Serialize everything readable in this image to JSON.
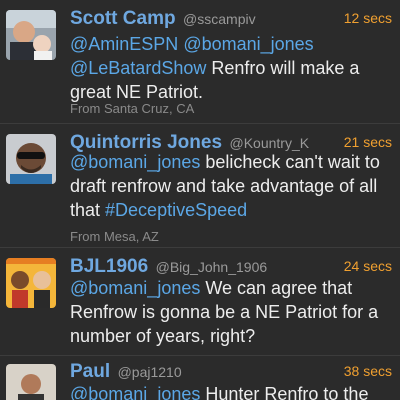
{
  "tweets": [
    {
      "name": "Scott Camp",
      "handle": "@sscampiv",
      "time": "12 secs",
      "segments": [
        {
          "type": "mention",
          "text": "@AminESPN"
        },
        {
          "type": "text",
          "text": " "
        },
        {
          "type": "mention",
          "text": "@bomani_jones"
        },
        {
          "type": "text",
          "text": " "
        },
        {
          "type": "mention",
          "text": "@LeBatardShow"
        },
        {
          "type": "text",
          "text": " Renfro will make a great NE Patriot."
        }
      ],
      "location": "From Santa Cruz, CA"
    },
    {
      "name": "Quintorris Jones",
      "handle": "@Kountry_K",
      "time": "21 secs",
      "segments": [
        {
          "type": "mention",
          "text": "@bomani_jones"
        },
        {
          "type": "text",
          "text": "  belicheck can't wait to draft renfrow and take advantage of all that "
        },
        {
          "type": "hashtag",
          "text": "#DeceptiveSpeed"
        }
      ],
      "location": "From Mesa, AZ"
    },
    {
      "name": "BJL1906",
      "handle": "@Big_John_1906",
      "time": "24 secs",
      "segments": [
        {
          "type": "mention",
          "text": "@bomani_jones"
        },
        {
          "type": "text",
          "text": " We can agree that Renfrow is gonna be a NE Patriot for a number of years, right?"
        }
      ],
      "location": ""
    },
    {
      "name": "Paul",
      "handle": "@paj1210",
      "time": "38 secs",
      "segments": [
        {
          "type": "mention",
          "text": "@bomani_jones"
        },
        {
          "type": "text",
          "text": " Hunter Renfro to the"
        }
      ],
      "location": ""
    }
  ]
}
